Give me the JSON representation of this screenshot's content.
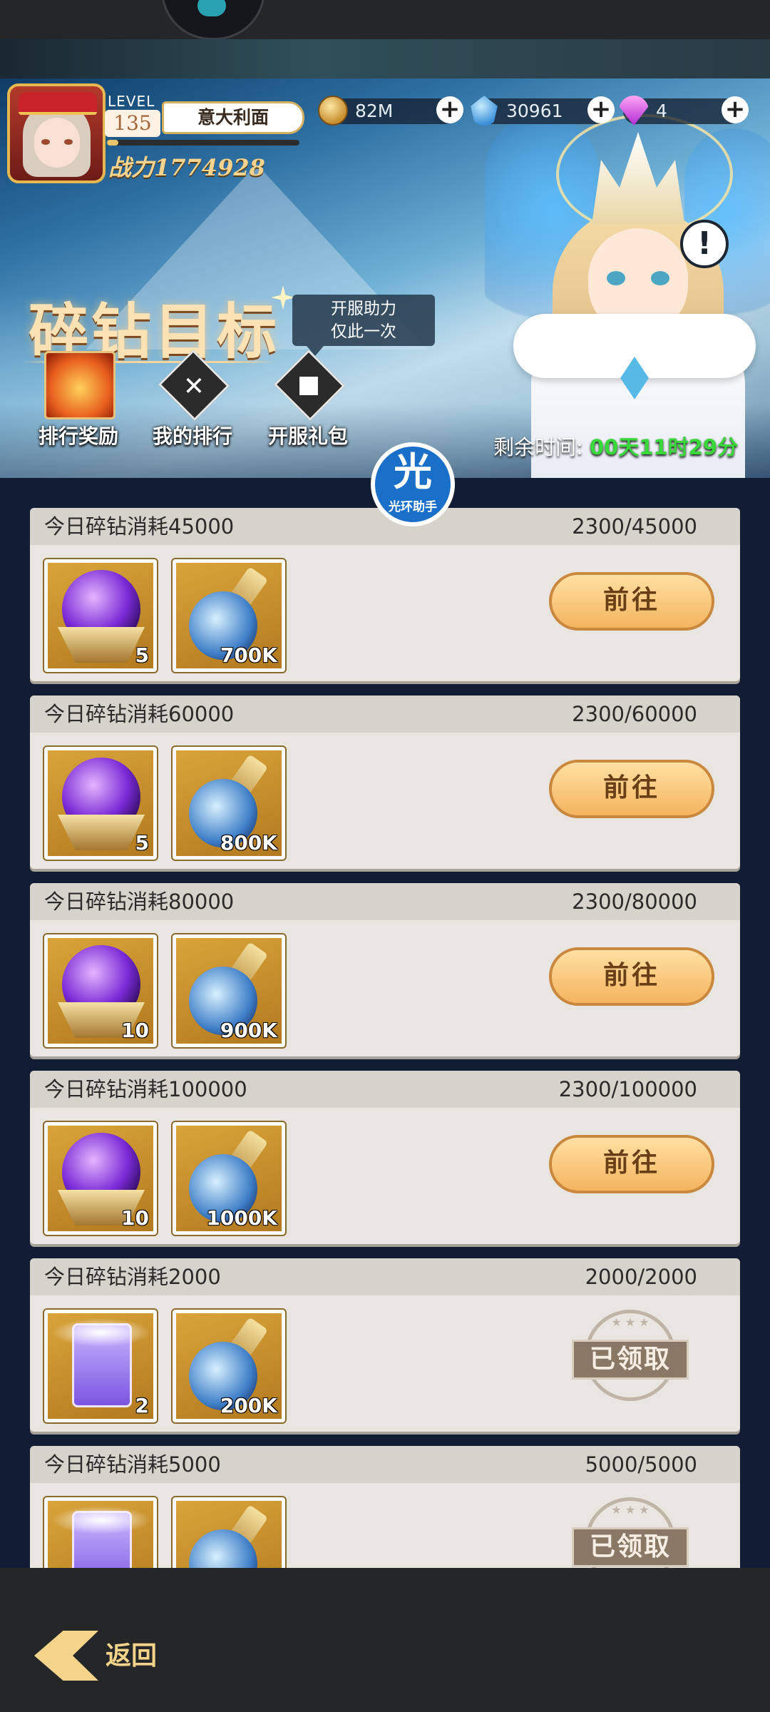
{
  "header": {
    "level_label": "LEVEL",
    "level": "135",
    "player_name": "意大利面",
    "exp_fraction": 0.06,
    "power_text": "战力1774928"
  },
  "resources": {
    "coins": "82M",
    "crystals": "30961",
    "diamonds": "4"
  },
  "event": {
    "title": "碎钻目标",
    "tip_line1": "开服助力",
    "tip_line2": "仅此一次",
    "timer_label": "剩余时间:",
    "timer_value": "00天11时29分"
  },
  "actions": [
    {
      "label": "排行奖励",
      "icon": "phoenix-icon"
    },
    {
      "label": "我的排行",
      "icon": "shield-icon"
    },
    {
      "label": "开服礼包",
      "icon": "gift-icon"
    }
  ],
  "assistant": {
    "big": "光",
    "small": "光环助手"
  },
  "buttons": {
    "goto": "前往",
    "claimed": "已领取"
  },
  "tasks": [
    {
      "title": "今日碎钻消耗45000",
      "progress": "2300/45000",
      "status": "goto",
      "items": [
        {
          "icon": "orb-icon",
          "qty": "5"
        },
        {
          "icon": "potion-icon",
          "qty": "700K"
        }
      ]
    },
    {
      "title": "今日碎钻消耗60000",
      "progress": "2300/60000",
      "status": "goto",
      "items": [
        {
          "icon": "orb-icon",
          "qty": "5"
        },
        {
          "icon": "potion-icon",
          "qty": "800K"
        }
      ]
    },
    {
      "title": "今日碎钻消耗80000",
      "progress": "2300/80000",
      "status": "goto",
      "items": [
        {
          "icon": "orb-icon",
          "qty": "10"
        },
        {
          "icon": "potion-icon",
          "qty": "900K"
        }
      ]
    },
    {
      "title": "今日碎钻消耗100000",
      "progress": "2300/100000",
      "status": "goto",
      "items": [
        {
          "icon": "orb-icon",
          "qty": "10"
        },
        {
          "icon": "potion-icon",
          "qty": "1000K"
        }
      ]
    },
    {
      "title": "今日碎钻消耗2000",
      "progress": "2000/2000",
      "status": "claimed",
      "items": [
        {
          "icon": "card-icon",
          "qty": "2"
        },
        {
          "icon": "potion-icon",
          "qty": "200K"
        }
      ]
    },
    {
      "title": "今日碎钻消耗5000",
      "progress": "5000/5000",
      "status": "claimed",
      "items": [
        {
          "icon": "card-icon",
          "qty": ""
        },
        {
          "icon": "potion-icon",
          "qty": ""
        }
      ]
    }
  ],
  "footer": {
    "back_label": "返回"
  }
}
